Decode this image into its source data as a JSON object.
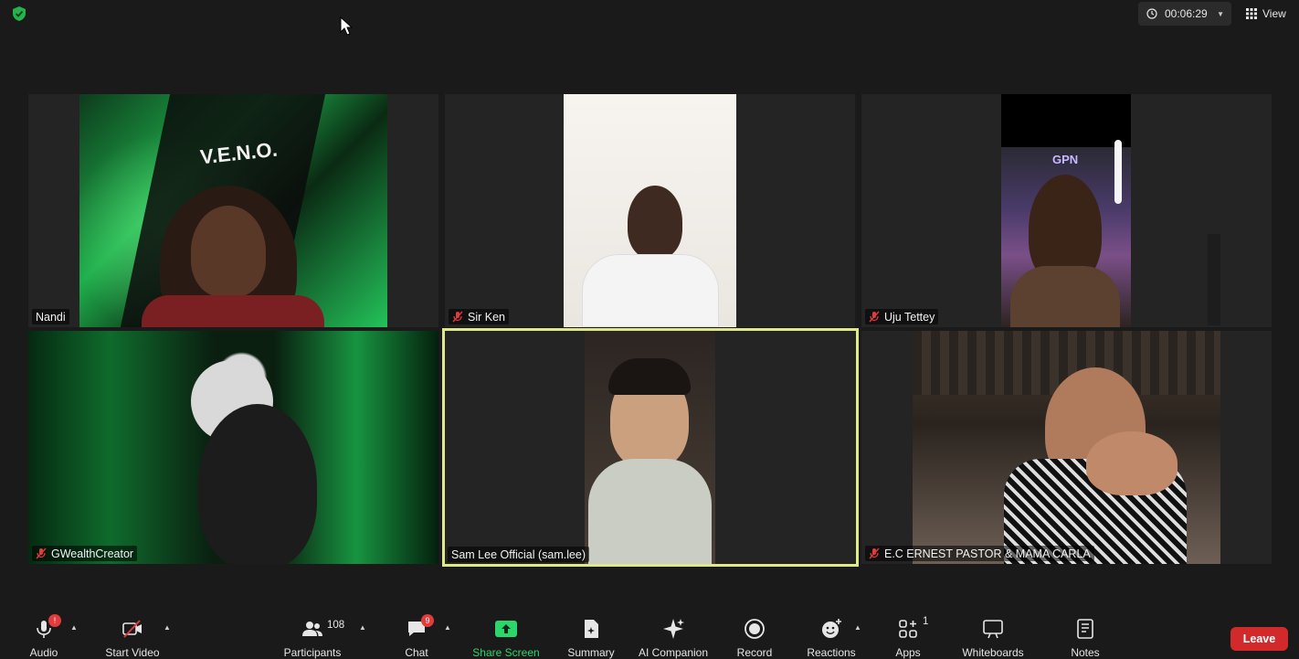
{
  "topbar": {
    "timer": "00:06:29",
    "view_label": "View"
  },
  "participants": [
    {
      "name": "Nandi",
      "muted": false
    },
    {
      "name": "Sir Ken",
      "muted": true
    },
    {
      "name": "Uju Tettey",
      "muted": true
    },
    {
      "name": "GWealthCreator",
      "muted": true
    },
    {
      "name": "Sam Lee Official (sam.lee)",
      "muted": false,
      "active_speaker": true
    },
    {
      "name": "E.C ERNEST PASTOR & MAMA CARLA",
      "muted": true
    }
  ],
  "video_overlays": {
    "veno_banner": "V.E.N.O.",
    "gpn_badge": "GPN"
  },
  "toolbar": {
    "audio": {
      "label": "Audio",
      "badge": "!"
    },
    "start_video": {
      "label": "Start Video"
    },
    "participants": {
      "label": "Participants",
      "count": "108"
    },
    "chat": {
      "label": "Chat",
      "badge": "9"
    },
    "share_screen": {
      "label": "Share Screen"
    },
    "summary": {
      "label": "Summary"
    },
    "ai_companion": {
      "label": "AI Companion"
    },
    "record": {
      "label": "Record"
    },
    "reactions": {
      "label": "Reactions"
    },
    "apps": {
      "label": "Apps",
      "count": "1"
    },
    "whiteboards": {
      "label": "Whiteboards"
    },
    "notes": {
      "label": "Notes"
    },
    "leave": {
      "label": "Leave"
    }
  },
  "colors": {
    "background": "#1a1a1a",
    "active_speaker_border": "#dfe88a",
    "share_green": "#2bd66b",
    "leave_red": "#d22a2a",
    "muted_red": "#e23b3b"
  }
}
